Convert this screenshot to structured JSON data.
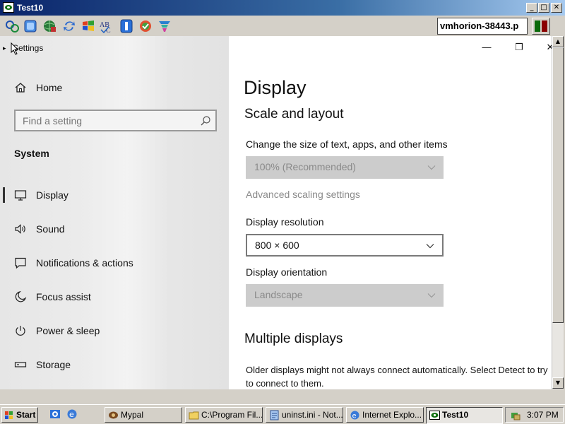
{
  "window": {
    "title": "Test10"
  },
  "toolbar": {
    "icons": [
      "connection-options-icon",
      "refresh-icon",
      "globe-icon",
      "transfer-icon",
      "windows-logo-icon",
      "spell-check-icon",
      "info-icon",
      "chat-icon",
      "tools-icon"
    ],
    "host": "vmhorion-38443.p"
  },
  "settings": {
    "app_title": "Settings",
    "home_label": "Home",
    "search_placeholder": "Find a setting",
    "section_heading": "System",
    "nav": [
      {
        "label": "Display",
        "icon": "monitor-icon",
        "selected": true
      },
      {
        "label": "Sound",
        "icon": "speaker-icon"
      },
      {
        "label": "Notifications & actions",
        "icon": "notification-icon"
      },
      {
        "label": "Focus assist",
        "icon": "moon-icon"
      },
      {
        "label": "Power & sleep",
        "icon": "power-icon"
      },
      {
        "label": "Storage",
        "icon": "storage-icon"
      }
    ],
    "controls": {
      "minimize": "—",
      "restore": "❐",
      "close": "✕"
    }
  },
  "display": {
    "title": "Display",
    "scale_section": "Scale and layout",
    "scale_label": "Change the size of text, apps, and other items",
    "scale_value": "100% (Recommended)",
    "advanced_link": "Advanced scaling settings",
    "resolution_label": "Display resolution",
    "resolution_value": "800 × 600",
    "orientation_label": "Display orientation",
    "orientation_value": "Landscape",
    "multi_section": "Multiple displays",
    "multi_desc": "Older displays might not always connect automatically. Select Detect to try to connect to them."
  },
  "taskbar": {
    "start": "Start",
    "tasks": [
      {
        "label": "Mypal",
        "icon": "mypal-icon"
      },
      {
        "label": "C:\\Program Fil...",
        "icon": "folder-icon"
      },
      {
        "label": "uninst.ini - Not...",
        "icon": "notepad-icon"
      },
      {
        "label": "Internet Explo...",
        "icon": "ie-icon"
      },
      {
        "label": "Test10",
        "icon": "vnc-icon",
        "active": true
      }
    ],
    "clock": "3:07 PM"
  }
}
